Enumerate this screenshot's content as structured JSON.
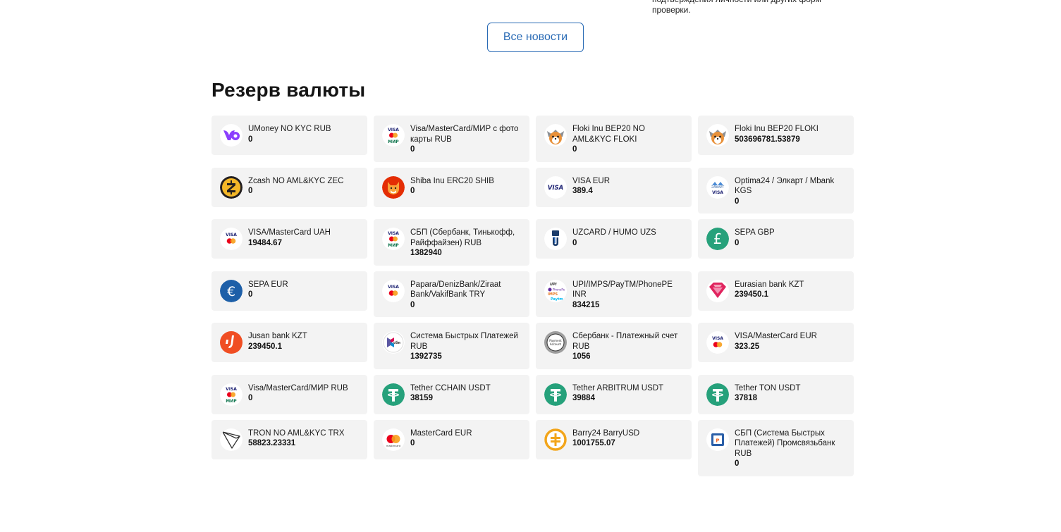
{
  "top_note": "подтверждения личности или других форм проверки.",
  "all_news_label": "Все новости",
  "section_title": "Резерв валюты",
  "rows": [
    [
      {
        "name": "UMoney NO KYC RUB",
        "amount": "0",
        "icon": "umoney-icon"
      },
      {
        "name": "Visa/MasterCard/МИР с фото карты RUB",
        "amount": "0",
        "icon": "visa-mastercard-mir-icon"
      },
      {
        "name": "Floki Inu BEP20 NO AML&KYC FLOKI",
        "amount": "0",
        "icon": "floki-icon"
      },
      {
        "name": "Floki Inu BEP20 FLOKI",
        "amount": "503696781.53879",
        "icon": "floki-icon"
      }
    ],
    [
      {
        "name": "Zcash NO AML&KYC ZEC",
        "amount": "0",
        "icon": "zcash-icon"
      },
      {
        "name": "Shiba Inu ERC20 SHIB",
        "amount": "0",
        "icon": "shiba-icon"
      },
      {
        "name": "VISA EUR",
        "amount": "389.4",
        "icon": "visa-icon"
      },
      {
        "name": "Optima24 / Элкарт / Mbank KGS",
        "amount": "0",
        "icon": "elcart-visa-icon"
      }
    ],
    [
      {
        "name": "VISA/MasterCard UAH",
        "amount": "19484.67",
        "icon": "visa-mastercard-icon"
      },
      {
        "name": "СБП (Сбербанк, Тинькофф, Райффайзен) RUB",
        "amount": "1382940",
        "icon": "visa-mastercard-mir-icon"
      },
      {
        "name": "UZCARD / HUMO UZS",
        "amount": "0",
        "icon": "uzcard-humo-icon"
      },
      {
        "name": "SEPA GBP",
        "amount": "0",
        "icon": "pound-icon"
      }
    ],
    [
      {
        "name": "SEPA EUR",
        "amount": "0",
        "icon": "euro-icon"
      },
      {
        "name": "Papara/DenizBank/Ziraat Bank/VakifBank TRY",
        "amount": "0",
        "icon": "visa-mastercard-icon"
      },
      {
        "name": "UPI/IMPS/PayTM/PhonePE INR",
        "amount": "834215",
        "icon": "upi-icon"
      },
      {
        "name": "Eurasian bank KZT",
        "amount": "239450.1",
        "icon": "eurasian-icon"
      }
    ],
    [
      {
        "name": "Jusan bank KZT",
        "amount": "239450.1",
        "icon": "jusan-icon"
      },
      {
        "name": "Система Быстрых Платежей RUB",
        "amount": "1392735",
        "icon": "sbp-icon"
      },
      {
        "name": "Сбербанк - Платежный счет RUB",
        "amount": "1056",
        "icon": "payment-account-icon"
      },
      {
        "name": "VISA/MasterCard EUR",
        "amount": "323.25",
        "icon": "visa-mastercard-icon"
      }
    ],
    [
      {
        "name": "Visa/MasterCard/МИР RUB",
        "amount": "0",
        "icon": "visa-mastercard-mir-icon"
      },
      {
        "name": "Tether CCHAIN USDT",
        "amount": "38159",
        "icon": "tether-icon"
      },
      {
        "name": "Tether ARBITRUM USDT",
        "amount": "39884",
        "icon": "tether-icon"
      },
      {
        "name": "Tether TON USDT",
        "amount": "37818",
        "icon": "tether-icon"
      }
    ],
    [
      {
        "name": "TRON NO AML&KYC TRX",
        "amount": "58823.23331",
        "icon": "tron-icon"
      },
      {
        "name": "MasterCard EUR",
        "amount": "0",
        "icon": "mastercard-icon"
      },
      {
        "name": "Barry24 BarryUSD",
        "amount": "1001755.07",
        "icon": "barry-icon"
      },
      {
        "name": "СБП (Система Быстрых Платежей) Промсвязьбанк RUB",
        "amount": "0",
        "icon": "psb-icon"
      }
    ]
  ],
  "colors": {
    "accent": "#2a6bb5",
    "card_bg": "#f3f3f3",
    "tether": "#26a17b",
    "umoney": "#8b3ffd",
    "shiba": "#e42d04",
    "euro": "#1d5fa8",
    "pound": "#27a17b",
    "barry": "#f2a51b",
    "jusan": "#f04e23",
    "eurasian": "#e0245e"
  }
}
